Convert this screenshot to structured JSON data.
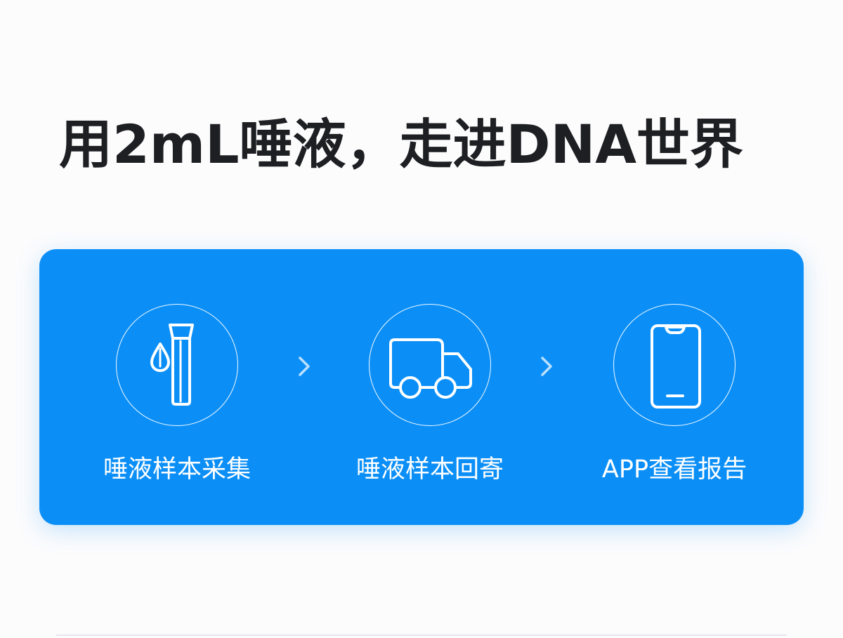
{
  "headline": "用2mL唾液，走进DNA世界",
  "steps": [
    {
      "label": "唾液样本采集",
      "icon": "saliva-tube-icon"
    },
    {
      "label": "唾液样本回寄",
      "icon": "delivery-truck-icon"
    },
    {
      "label": "APP查看报告",
      "icon": "smartphone-icon"
    }
  ],
  "colors": {
    "card_background": "#0b8ff7",
    "headline_text": "#1e1f22",
    "step_text": "#ffffff"
  }
}
